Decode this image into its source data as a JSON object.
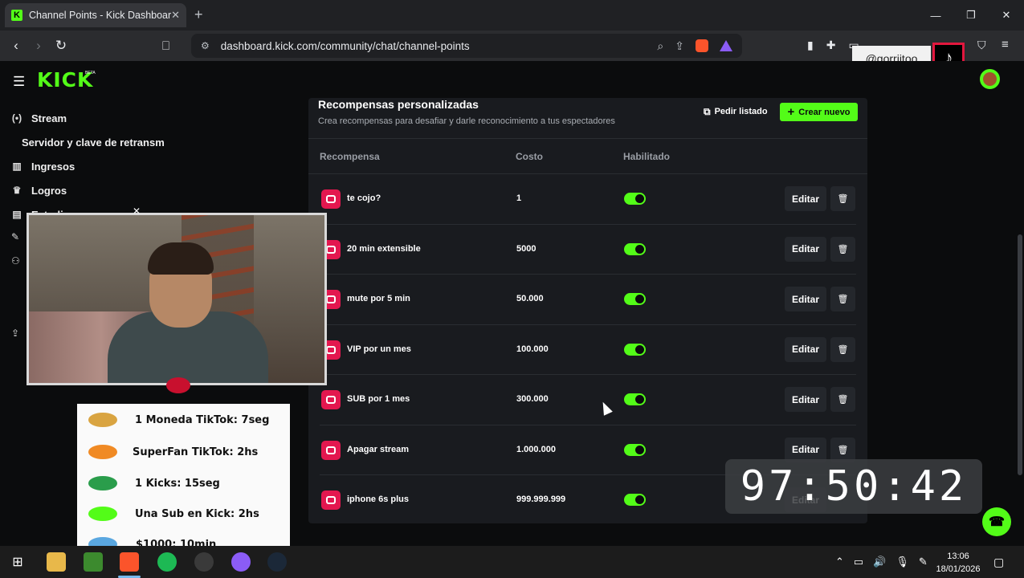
{
  "browser": {
    "tab_title": "Channel Points - Kick Dashboard",
    "tab_favicon": "K",
    "url": "dashboard.kick.com/community/chat/channel-points"
  },
  "overlay": {
    "tiktok_handle": "@gorriitoo"
  },
  "app": {
    "logo": "KICK",
    "logo_badge": "BETA"
  },
  "sidebar": {
    "items": [
      {
        "label": "Stream",
        "icon": "broadcast-icon"
      },
      {
        "label": "Servidor y clave de retransm",
        "icon": ""
      },
      {
        "label": "Ingresos",
        "icon": "chart-icon"
      },
      {
        "label": "Logros",
        "icon": "trophy-icon"
      },
      {
        "label": "Estudio",
        "icon": "studio-icon"
      }
    ]
  },
  "panel": {
    "title": "Recompensas personalizadas",
    "description": "Crea recompensas para desafiar y darle reconocimiento a tus espectadores",
    "list_button": "Pedir listado",
    "create_button": "Crear nuevo",
    "columns": {
      "reward": "Recompensa",
      "cost": "Costo",
      "enabled": "Habilitado"
    },
    "edit_label": "Editar",
    "rewards": [
      {
        "name": "te cojo?",
        "cost": "1",
        "enabled": true
      },
      {
        "name": "20 min extensible",
        "cost": "5000",
        "enabled": true
      },
      {
        "name": "mute por 5 min",
        "cost": "50.000",
        "enabled": true
      },
      {
        "name": "VIP por un mes",
        "cost": "100.000",
        "enabled": true
      },
      {
        "name": "SUB por 1 mes",
        "cost": "300.000",
        "enabled": true
      },
      {
        "name": "Apagar stream",
        "cost": "1.000.000",
        "enabled": true
      },
      {
        "name": "iphone 6s plus",
        "cost": "999.999.999",
        "enabled": true
      }
    ]
  },
  "alerts": [
    {
      "text": "1 Moneda TikTok: 7seg",
      "color": "#d9a441"
    },
    {
      "text": "SuperFan TikTok: 2hs",
      "color": "#f08a24"
    },
    {
      "text": "1 Kicks: 15seg",
      "color": "#2a9d4b"
    },
    {
      "text": "Una Sub en Kick: 2hs",
      "color": "#53fc18"
    },
    {
      "text": "$1000: 10min",
      "color": "#5aa7e0"
    }
  ],
  "timer": "97:50:42",
  "taskbar": {
    "time": "13:06",
    "date": "18/01/2026"
  },
  "colors": {
    "kick_green": "#53fc18",
    "reward_icon": "#e3174f",
    "panel_bg": "#191b1f"
  }
}
